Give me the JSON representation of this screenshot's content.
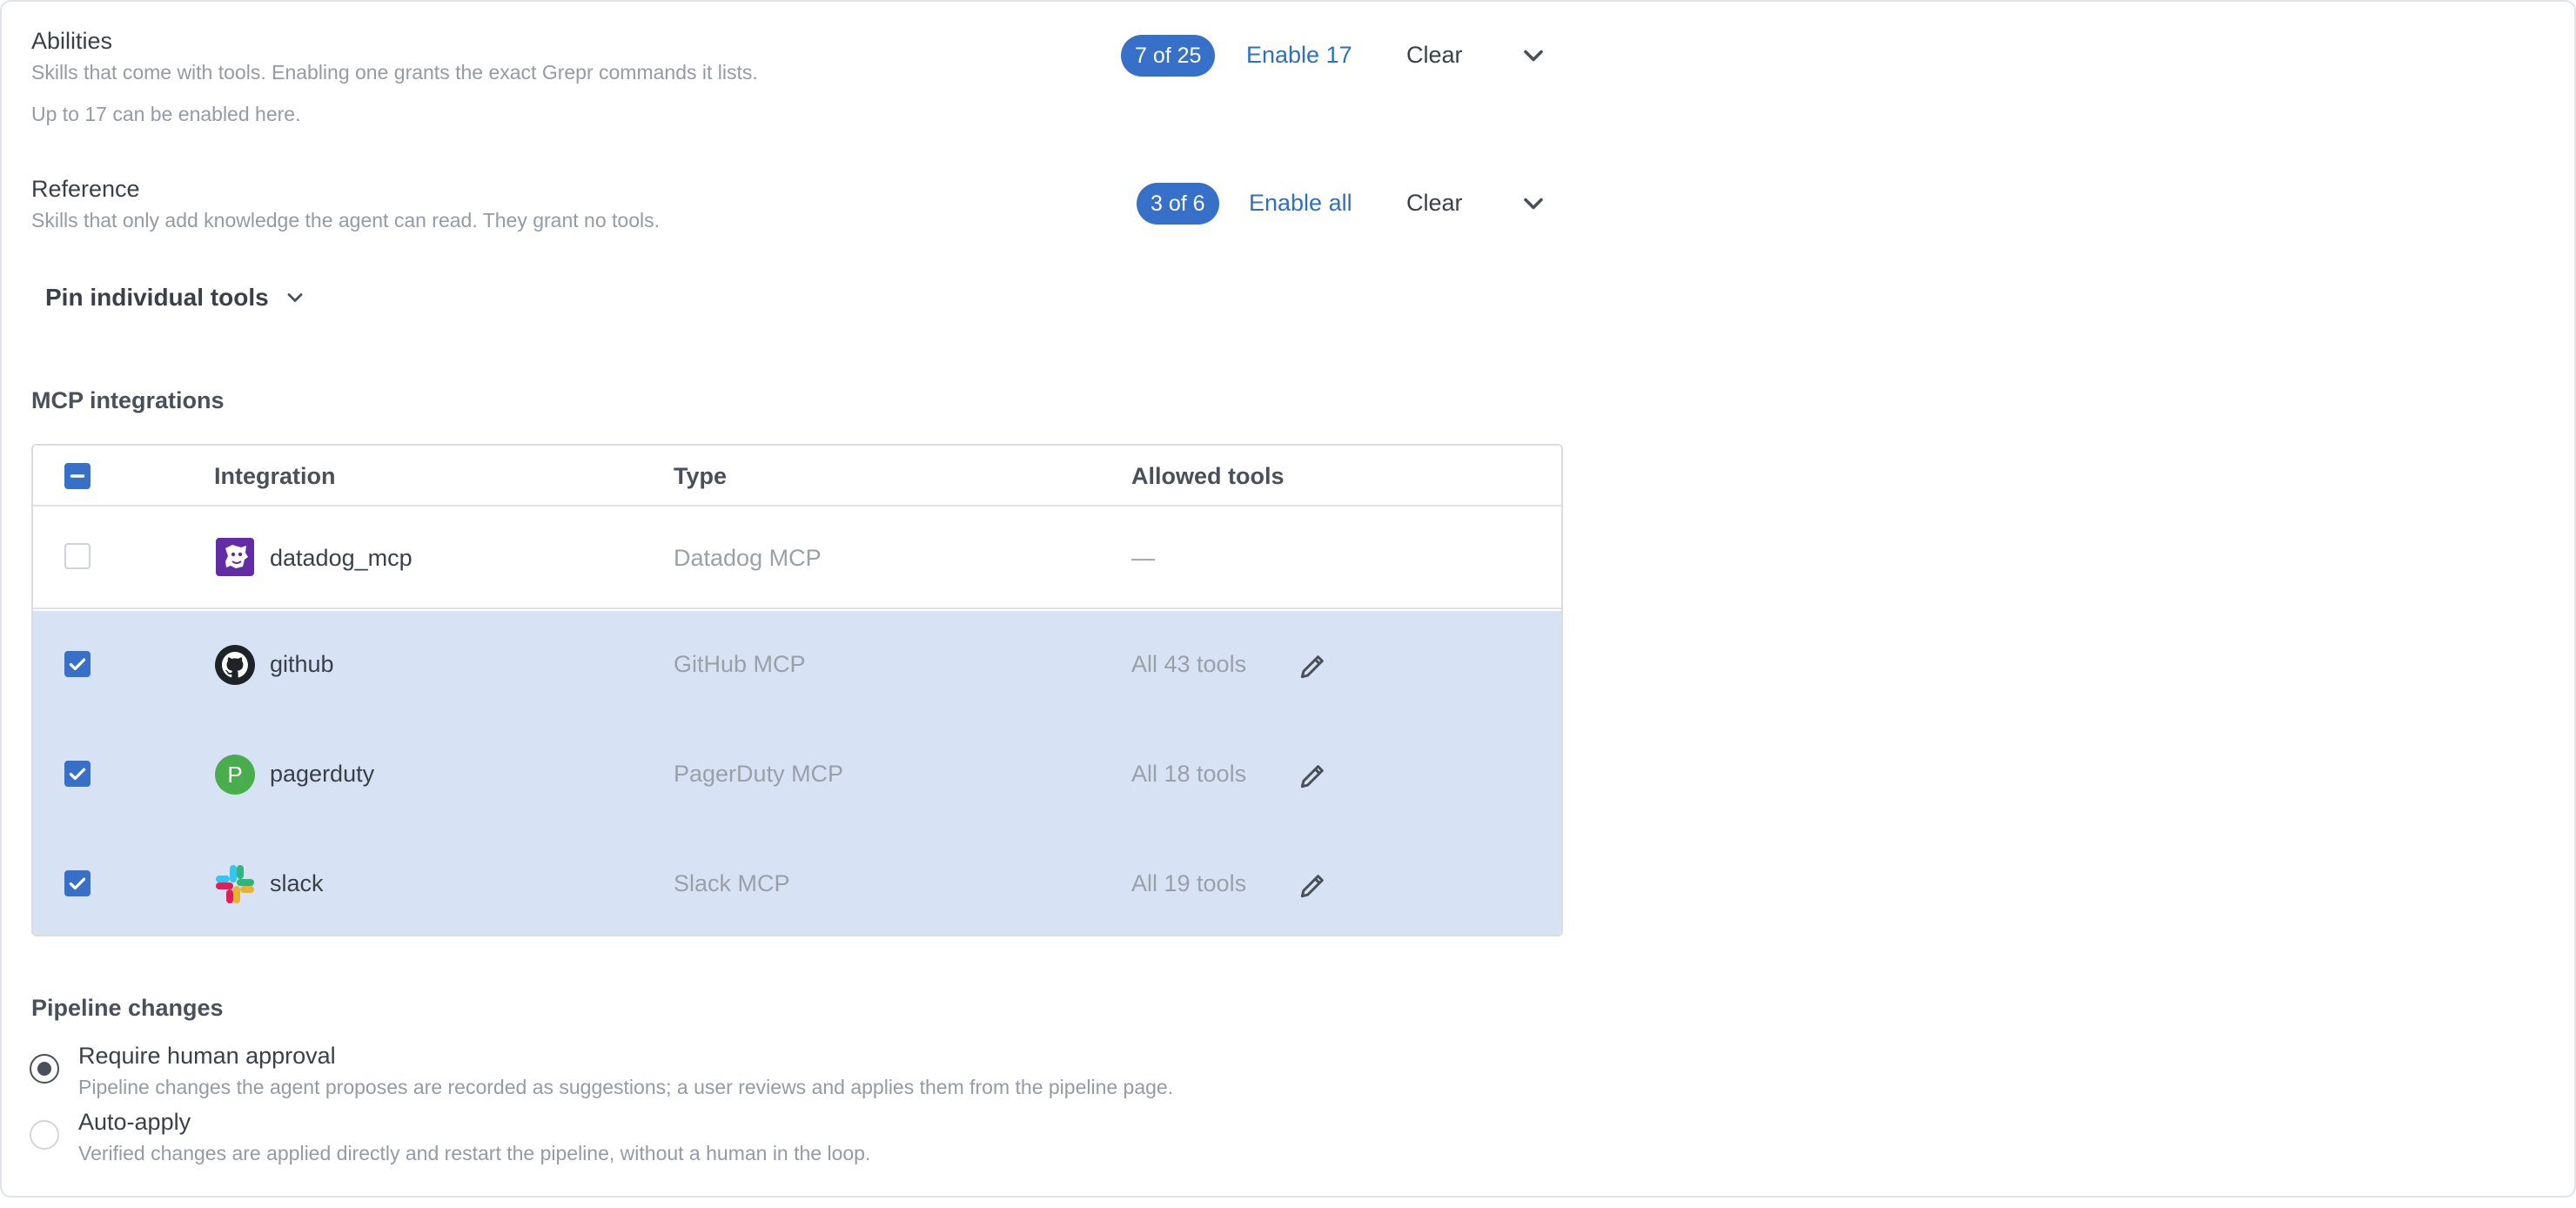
{
  "skills": {
    "abilities": {
      "title": "Abilities",
      "description": "Skills that come with tools. Enabling one grants the exact Grepr commands it lists.",
      "note": "Up to 17 can be enabled here.",
      "count": "7 of 25",
      "enable_label": "Enable 17",
      "clear_label": "Clear",
      "expand_icon": "chevron-down-icon"
    },
    "reference": {
      "title": "Reference",
      "description": "Skills that only add knowledge the agent can read. They grant no tools.",
      "count": "3 of 6",
      "enable_label": "Enable all",
      "clear_label": "Clear",
      "expand_icon": "chevron-down-icon"
    },
    "pin_tools_label": "Pin individual tools"
  },
  "mcp": {
    "heading": "MCP integrations",
    "columns": [
      "Integration",
      "Type",
      "Allowed tools"
    ],
    "rows": [
      {
        "name": "datadog_mcp",
        "type": "Datadog MCP",
        "allowed": "—",
        "checked": false,
        "icon": "datadog-icon"
      },
      {
        "name": "github",
        "type": "GitHub MCP",
        "allowed": "All 43 tools",
        "checked": true,
        "icon": "github-icon"
      },
      {
        "name": "pagerduty",
        "type": "PagerDuty MCP",
        "allowed": "All 18 tools",
        "checked": true,
        "icon": "pagerduty-icon",
        "icon_letter": "P"
      },
      {
        "name": "slack",
        "type": "Slack MCP",
        "allowed": "All 19 tools",
        "checked": true,
        "icon": "slack-icon"
      }
    ]
  },
  "pipeline": {
    "heading": "Pipeline changes",
    "options": [
      {
        "label": "Require human approval",
        "description": "Pipeline changes the agent proposes are recorded as suggestions; a user reviews and applies them from the pipeline page.",
        "selected": true
      },
      {
        "label": "Auto-apply",
        "description": "Verified changes are applied directly and restart the pipeline, without a human in the loop.",
        "selected": false
      }
    ]
  },
  "colors": {
    "accent": "#3670c9",
    "link": "#2e6fc4",
    "selected_row": "#d7e3f4",
    "pagerduty_green": "#4aad4d",
    "datadog_purple": "#632ca6"
  }
}
